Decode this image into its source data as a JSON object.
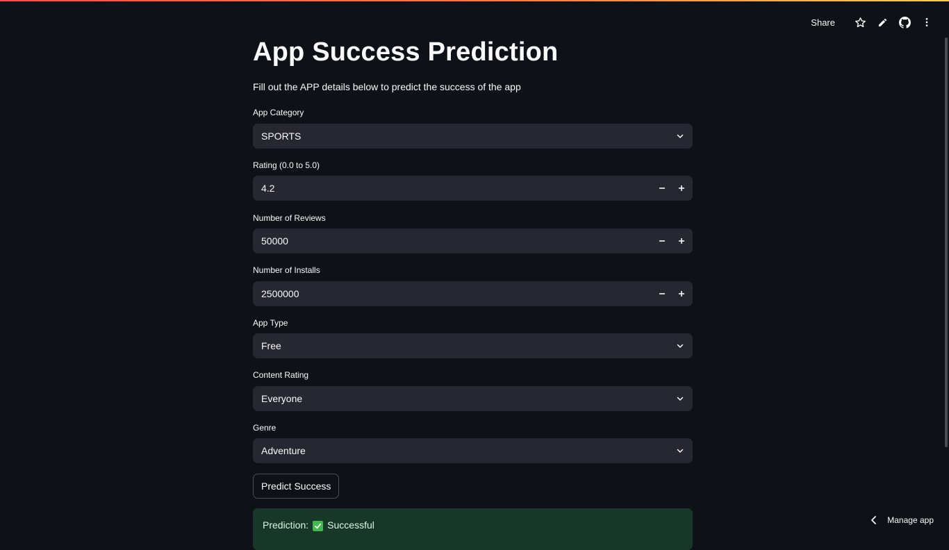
{
  "toolbar": {
    "share_label": "Share",
    "icons": [
      "star-icon",
      "pencil-icon",
      "github-icon",
      "more-vertical-icon"
    ]
  },
  "page": {
    "title": "App Success Prediction",
    "subtitle": "Fill out the APP details below to predict the success of the app"
  },
  "form": {
    "app_category": {
      "label": "App Category",
      "value": "SPORTS"
    },
    "rating": {
      "label": "Rating (0.0 to 5.0)",
      "value": "4.2"
    },
    "reviews": {
      "label": "Number of Reviews",
      "value": "50000"
    },
    "installs": {
      "label": "Number of Installs",
      "value": "2500000"
    },
    "app_type": {
      "label": "App Type",
      "value": "Free"
    },
    "content_rating": {
      "label": "Content Rating",
      "value": "Everyone"
    },
    "genre": {
      "label": "Genre",
      "value": "Adventure"
    },
    "stepper": {
      "minus": "−",
      "plus": "+"
    }
  },
  "actions": {
    "predict_label": "Predict Success"
  },
  "result": {
    "prefix": "Prediction:",
    "value": "Successful"
  },
  "footer": {
    "manage_label": "Manage app"
  },
  "colors": {
    "background": "#0e1117",
    "input": "#262730",
    "success_bg": "#173828",
    "accent_red": "#ff4b4b"
  }
}
